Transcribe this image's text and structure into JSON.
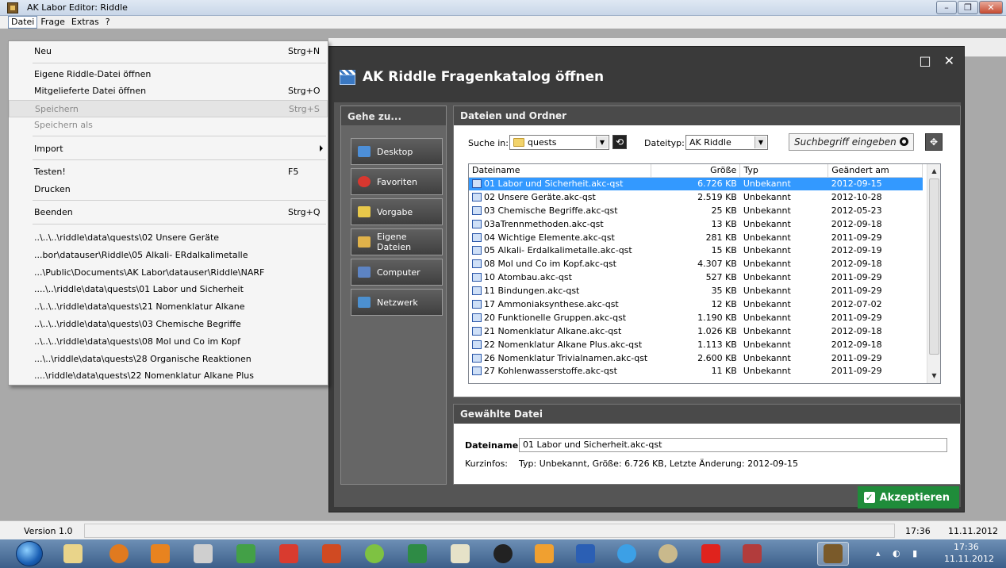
{
  "window": {
    "title": "AK Labor Editor: Riddle"
  },
  "menubar": {
    "items": [
      "Datei",
      "Frage",
      "Extras",
      "?"
    ]
  },
  "file_menu": {
    "items": [
      {
        "label": "Neu",
        "shortcut": "Strg+N"
      },
      {
        "label": "Eigene Riddle-Datei öffnen",
        "shortcut": ""
      },
      {
        "label": "Mitgelieferte Datei öffnen",
        "shortcut": "Strg+O"
      },
      {
        "label": "Speichern",
        "shortcut": "Strg+S"
      },
      {
        "label": "Speichern als",
        "shortcut": ""
      },
      {
        "label": "Import",
        "shortcut": ""
      },
      {
        "label": "Testen!",
        "shortcut": "F5"
      },
      {
        "label": "Drucken",
        "shortcut": ""
      },
      {
        "label": "Beenden",
        "shortcut": "Strg+Q"
      }
    ],
    "recent": [
      "..\\..\\..\\riddle\\data\\quests\\02 Unsere Geräte",
      "...bor\\datauser\\Riddle\\05 Alkali- ERdalkalimetalle",
      "...\\Public\\Documents\\AK Labor\\datauser\\Riddle\\NARF",
      "....\\..\\riddle\\data\\quests\\01 Labor und Sicherheit",
      "..\\..\\..\\riddle\\data\\quests\\21 Nomenklatur Alkane",
      "..\\..\\..\\riddle\\data\\quests\\03 Chemische Begriffe",
      "..\\..\\..\\riddle\\data\\quests\\08 Mol und Co im Kopf",
      "...\\..\\riddle\\data\\quests\\28 Organische Reaktionen",
      "....\\riddle\\data\\quests\\22 Nomenklatur Alkane Plus"
    ]
  },
  "dialog": {
    "title": "AK Riddle Fragenkatalog öffnen",
    "nav_header": "Gehe zu...",
    "nav": [
      "Desktop",
      "Favoriten",
      "Vorgabe",
      "Eigene Dateien",
      "Computer",
      "Netzwerk"
    ],
    "files_header": "Dateien und Ordner",
    "search_in_label": "Suche in:",
    "search_in_value": "quests",
    "filetype_label": "Dateityp:",
    "filetype_value": "AK Riddle",
    "search_placeholder": "Suchbegriff eingeben",
    "columns": [
      "Dateiname",
      "Größe",
      "Typ",
      "Geändert am"
    ],
    "rows": [
      [
        "01 Labor und Sicherheit.akc-qst",
        "6.726 KB",
        "Unbekannt",
        "2012-09-15"
      ],
      [
        "02 Unsere Geräte.akc-qst",
        "2.519 KB",
        "Unbekannt",
        "2012-10-28"
      ],
      [
        "03 Chemische Begriffe.akc-qst",
        "25 KB",
        "Unbekannt",
        "2012-05-23"
      ],
      [
        "03aTrennmethoden.akc-qst",
        "13 KB",
        "Unbekannt",
        "2012-09-18"
      ],
      [
        "04 Wichtige Elemente.akc-qst",
        "281 KB",
        "Unbekannt",
        "2011-09-29"
      ],
      [
        "05 Alkali- Erdalkalimetalle.akc-qst",
        "15 KB",
        "Unbekannt",
        "2012-09-19"
      ],
      [
        "08 Mol und Co im Kopf.akc-qst",
        "4.307 KB",
        "Unbekannt",
        "2012-09-18"
      ],
      [
        "10 Atombau.akc-qst",
        "527 KB",
        "Unbekannt",
        "2011-09-29"
      ],
      [
        "11 Bindungen.akc-qst",
        "35 KB",
        "Unbekannt",
        "2011-09-29"
      ],
      [
        "17 Ammoniaksynthese.akc-qst",
        "12 KB",
        "Unbekannt",
        "2012-07-02"
      ],
      [
        "20 Funktionelle Gruppen.akc-qst",
        "1.190 KB",
        "Unbekannt",
        "2011-09-29"
      ],
      [
        "21 Nomenklatur Alkane.akc-qst",
        "1.026 KB",
        "Unbekannt",
        "2012-09-18"
      ],
      [
        "22 Nomenklatur Alkane Plus.akc-qst",
        "1.113 KB",
        "Unbekannt",
        "2012-09-18"
      ],
      [
        "26 Nomenklatur Trivialnamen.akc-qst",
        "2.600 KB",
        "Unbekannt",
        "2011-09-29"
      ],
      [
        "27 Kohlenwasserstoffe.akc-qst",
        "11 KB",
        "Unbekannt",
        "2011-09-29"
      ]
    ],
    "selected_header": "Gewählte Datei",
    "filename_label": "Dateiname:",
    "filename_value": "01 Labor und Sicherheit.akc-qst",
    "info_label": "Kurzinfos:",
    "info_value": "Typ: Unbekannt, Größe: 6.726 KB, Letzte Änderung: 2012-09-15",
    "accept_label": "Akzeptieren"
  },
  "statusbar": {
    "version": "Version 1.0",
    "time": "17:36",
    "date": "11.11.2012"
  },
  "taskbar": {
    "clock_time": "17:36",
    "clock_date": "11.11.2012"
  },
  "colors": {
    "selection": "#3399ff",
    "accept": "#1f8c3a",
    "dialog_bg": "#3a3a3a"
  }
}
